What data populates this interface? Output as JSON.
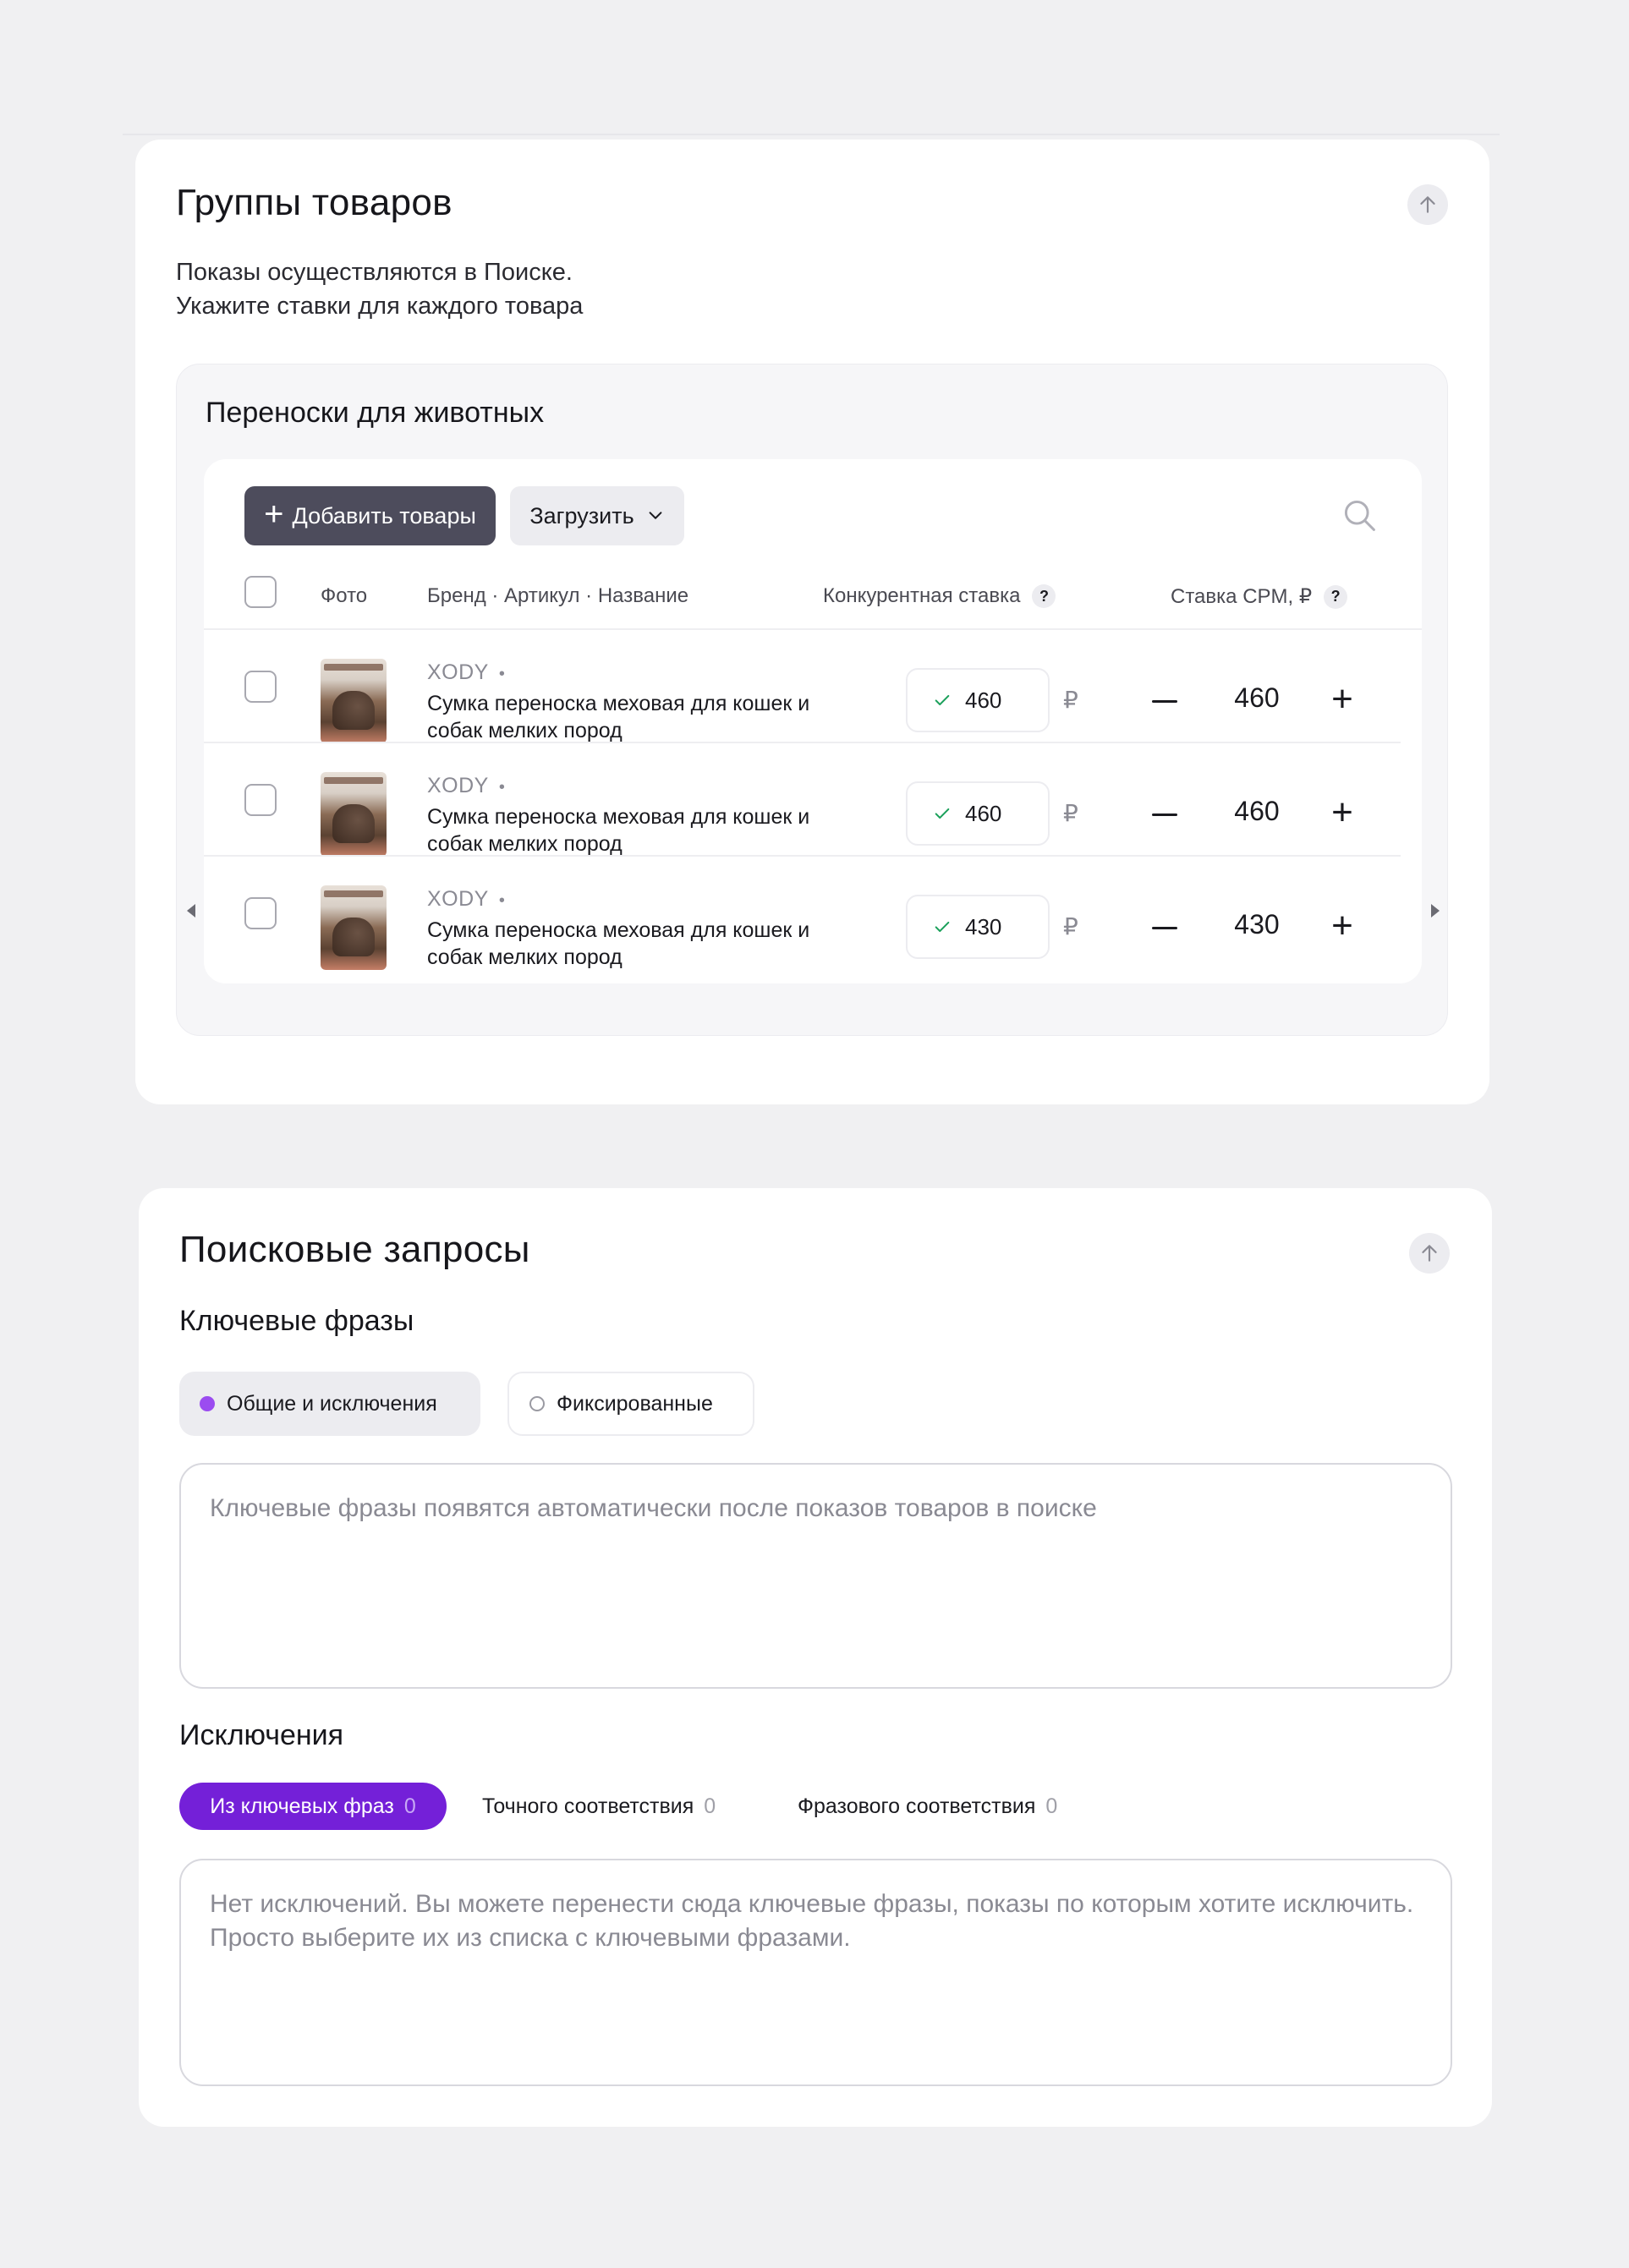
{
  "products_card": {
    "title": "Группы товаров",
    "subtitle_line1": "Показы осуществляются в Поиске.",
    "subtitle_line2": "Укажите ставки для каждого товара",
    "group": {
      "title": "Переноски для животных",
      "add_button": "Добавить товары",
      "upload_button": "Загрузить",
      "columns": {
        "photo": "Фото",
        "name": "Бренд · Артикул · Название",
        "competitive_bid": "Конкурентная ставка",
        "cpm_bid": "Ставка CPM, ₽",
        "help": "?"
      },
      "rows": [
        {
          "brand": "XODY",
          "name": "Сумка переноска меховая для кошек и собак мелких пород",
          "competitive_bid": "460",
          "currency": "₽",
          "cpm": "460"
        },
        {
          "brand": "XODY",
          "name": "Сумка переноска меховая для кошек и собак мелких пород",
          "competitive_bid": "460",
          "currency": "₽",
          "cpm": "460"
        },
        {
          "brand": "XODY",
          "name": "Сумка переноска меховая для кошек и собак мелких пород",
          "competitive_bid": "430",
          "currency": "₽",
          "cpm": "430"
        }
      ]
    }
  },
  "search_card": {
    "title": "Поисковые запросы",
    "keywords_heading": "Ключевые фразы",
    "radio_general": "Общие и исключения",
    "radio_fixed": "Фиксированные",
    "keywords_placeholder": "Ключевые фразы появятся автоматически после показов товаров в поиске",
    "exclusions_heading": "Исключения",
    "tabs": [
      {
        "label": "Из ключевых фраз",
        "count": "0"
      },
      {
        "label": "Точного соответствия",
        "count": "0"
      },
      {
        "label": "Фразового соответствия",
        "count": "0"
      }
    ],
    "exclusions_text_line1": "Нет исключений. Вы можете перенести сюда ключевые фразы, показы по которым хотите исключить.",
    "exclusions_text_line2": "Просто выберите их из списка с ключевыми фразами."
  },
  "colors": {
    "accent_purple": "#7420d8",
    "radio_purple": "#9b4cf0",
    "dark_button": "#4d4c5c",
    "check_green": "#1aa05a"
  }
}
